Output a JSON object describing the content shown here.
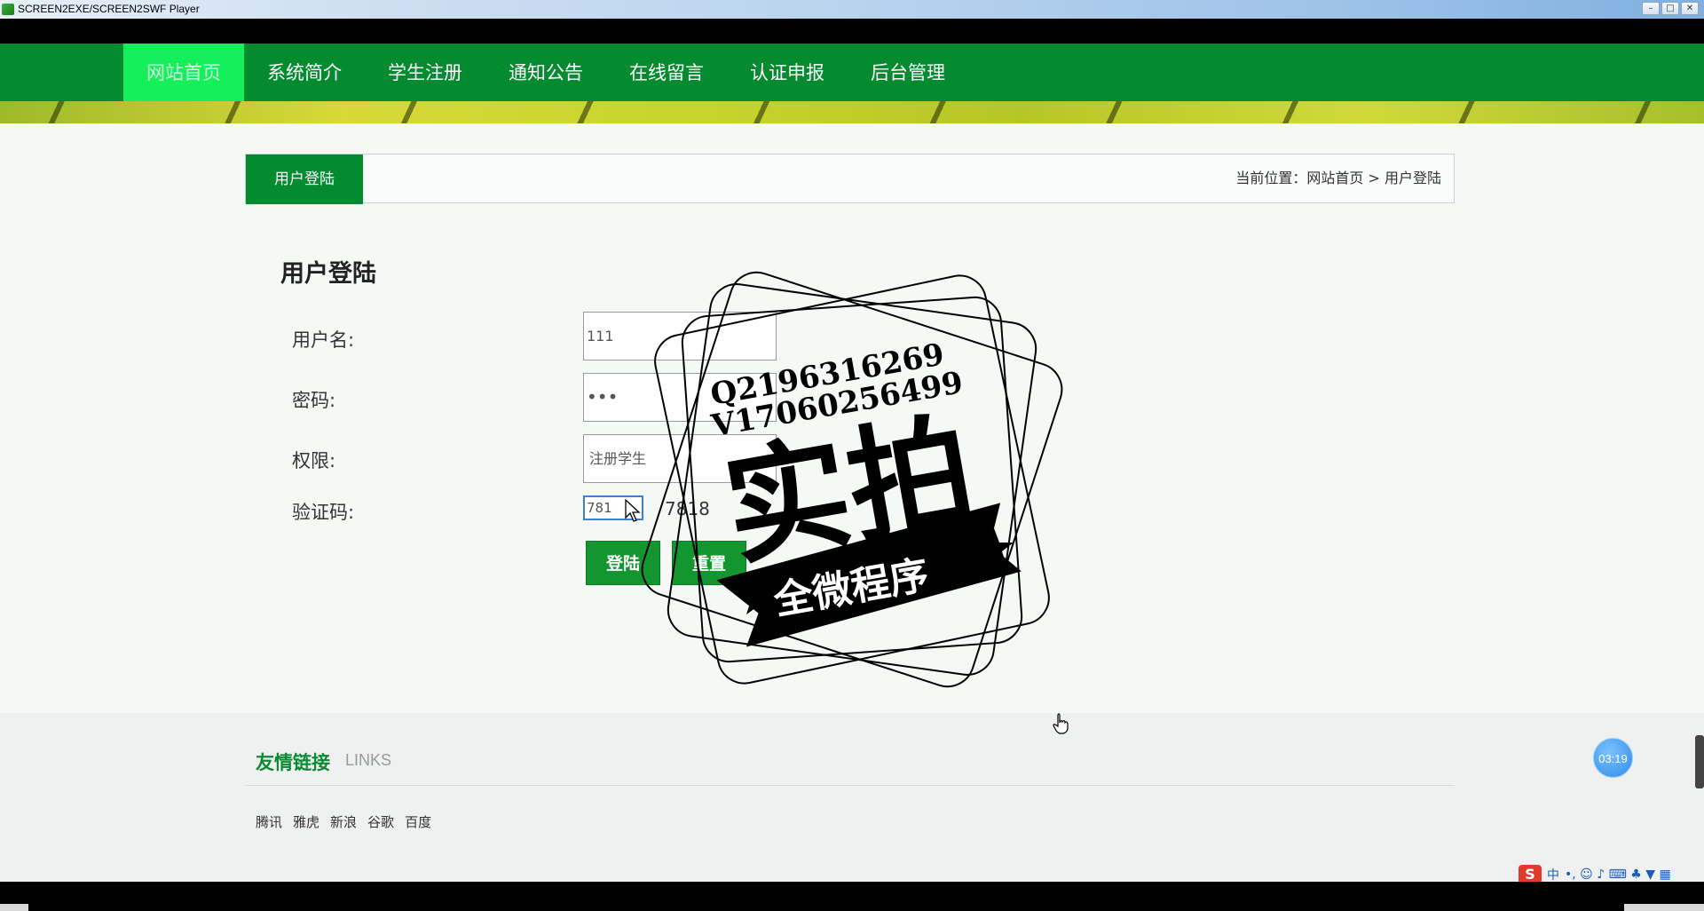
{
  "window": {
    "title": "SCREEN2EXE/SCREEN2SWF Player",
    "controls": [
      "–",
      "□",
      "✕"
    ]
  },
  "nav": {
    "items": [
      {
        "label": "网站首页",
        "active": true
      },
      {
        "label": "系统简介"
      },
      {
        "label": "学生注册"
      },
      {
        "label": "通知公告"
      },
      {
        "label": "在线留言"
      },
      {
        "label": "认证申报"
      },
      {
        "label": "后台管理"
      }
    ]
  },
  "breadcrumb": {
    "tab": "用户登陆",
    "path": "当前位置：网站首页 > 用户登陆"
  },
  "form": {
    "title": "用户登陆",
    "username_label": "用户名:",
    "username_value": "111",
    "password_label": "密码:",
    "password_value": "•••",
    "role_label": "权限:",
    "role_value": "注册学生",
    "captcha_label": "验证码:",
    "captcha_input": "781",
    "captcha_code": "7818",
    "login_button": "登陆",
    "reset_button": "重置"
  },
  "watermark": {
    "line1": "Q2196316269",
    "line2": "V17060256499",
    "main": "实拍",
    "ribbon": "全微程序"
  },
  "footer": {
    "links_title": "友情链接",
    "links_sub": "LINKS",
    "links": [
      "腾讯",
      "雅虎",
      "新浪",
      "谷歌",
      "百度"
    ]
  },
  "player": {
    "timer": "03:19"
  },
  "ime": {
    "logo": "S",
    "mode": "中",
    "icons": "•, ☺ ♪ ⌨ ♣ ▼ ▦"
  },
  "colors": {
    "nav_green": "#048a2f",
    "active_green": "#15f05a",
    "button_green": "#13962f"
  }
}
